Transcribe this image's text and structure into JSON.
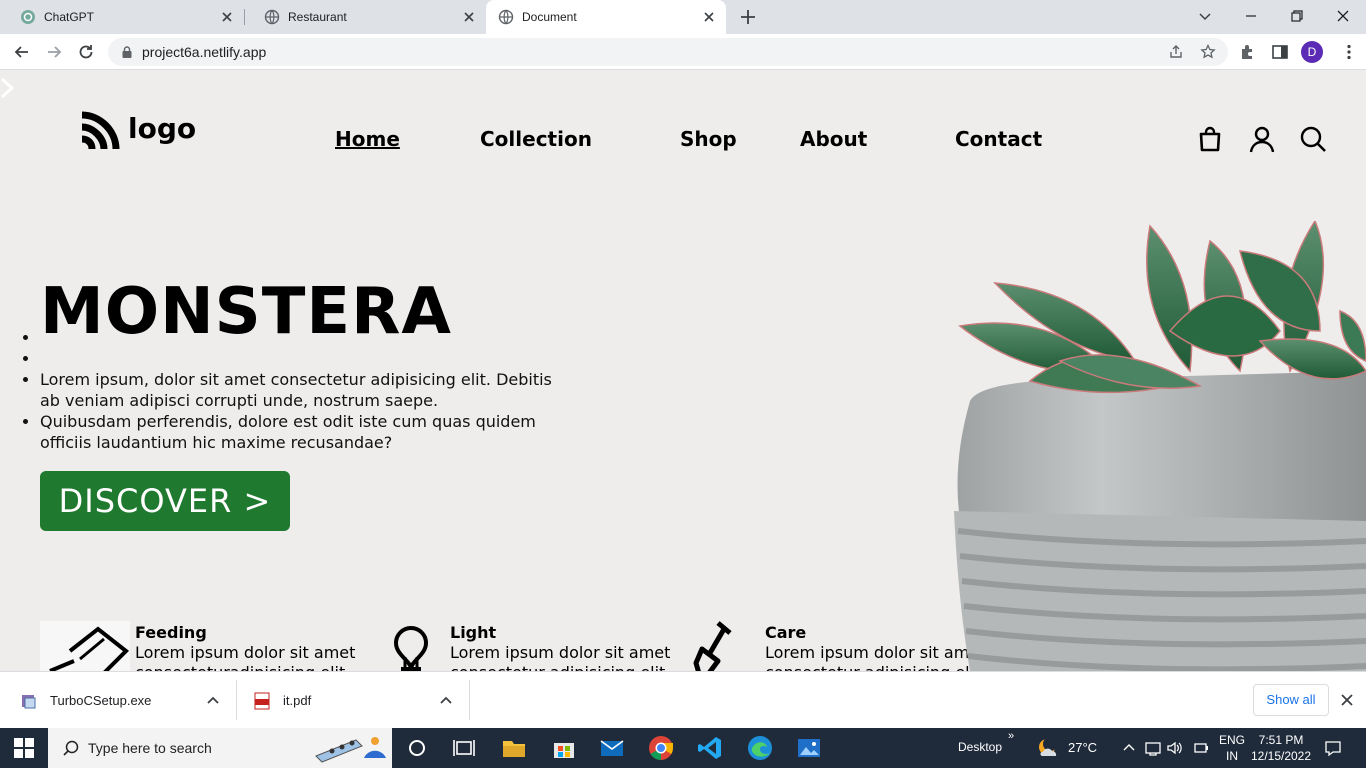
{
  "browser": {
    "tabs": [
      {
        "title": "ChatGPT",
        "active": false
      },
      {
        "title": "Restaurant",
        "active": false
      },
      {
        "title": "Document",
        "active": true
      }
    ],
    "url": "project6a.netlify.app",
    "profile_initial": "D"
  },
  "page": {
    "logo_text": "logo",
    "nav": [
      "Home",
      "Collection",
      "Shop",
      "About",
      "Contact"
    ],
    "active_nav": "Home",
    "header_icons": [
      "shopping-bag-icon",
      "user-icon",
      "search-icon"
    ],
    "hero": {
      "title": "MONSTERA",
      "bullets": [
        "",
        "",
        "Lorem ipsum, dolor sit amet consectetur adipisicing elit. Debitis ab veniam adipisci corrupti unde, nostrum saepe.",
        "Quibusdam perferendis, dolore est odit iste cum quas quidem officiis laudantium hic maxime recusandae?"
      ],
      "button": "DISCOVER >"
    },
    "features": [
      {
        "title": "Feeding",
        "text": "Lorem ipsum dolor sit amet consecteturadipisicing elit",
        "icon": "watering-can-icon"
      },
      {
        "title": "Light",
        "text": "Lorem ipsum dolor sit amet consectetur adipisicing elit",
        "icon": "lightbulb-icon"
      },
      {
        "title": "Care",
        "text": "Lorem ipsum dolor sit amet consectetur adipisicing elit",
        "icon": "shovel-icon"
      }
    ],
    "accent_color": "#1f7a30"
  },
  "downloads": {
    "items": [
      "TurboCSetup.exe",
      "it.pdf"
    ],
    "show_all": "Show all"
  },
  "taskbar": {
    "search_placeholder": "Type here to search",
    "desktop_label": "Desktop",
    "weather": "27°C",
    "lang_line1": "ENG",
    "lang_line2": "IN",
    "time": "7:51 PM",
    "date": "12/15/2022"
  }
}
